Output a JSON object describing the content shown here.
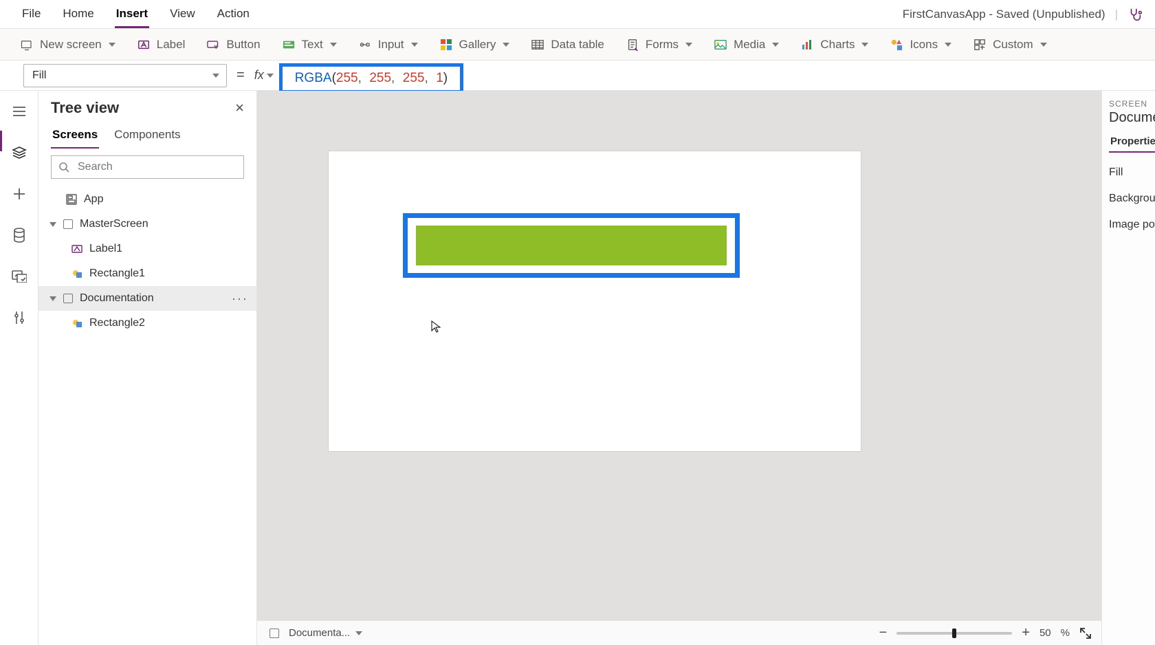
{
  "appTitle": "FirstCanvasApp - Saved (Unpublished)",
  "menu": {
    "items": [
      "File",
      "Home",
      "Insert",
      "View",
      "Action"
    ],
    "activeIndex": 2
  },
  "ribbon": {
    "newScreen": "New screen",
    "label": "Label",
    "button": "Button",
    "text": "Text",
    "input": "Input",
    "gallery": "Gallery",
    "dataTable": "Data table",
    "forms": "Forms",
    "media": "Media",
    "charts": "Charts",
    "icons": "Icons",
    "custom": "Custom"
  },
  "formula": {
    "property": "Fill",
    "fxLabel": "fx",
    "tokens": {
      "func": "RGBA",
      "open": "(",
      "n1": "255",
      "c": ",",
      "n2": "255",
      "n3": "255",
      "n4": "1",
      "close": ")"
    }
  },
  "treePanel": {
    "title": "Tree view",
    "tabs": {
      "screens": "Screens",
      "components": "Components",
      "activeIndex": 0
    },
    "searchPlaceholder": "Search",
    "appNode": "App",
    "items": [
      {
        "kind": "screen",
        "name": "MasterScreen",
        "expanded": true,
        "selected": false
      },
      {
        "kind": "label",
        "name": "Label1",
        "selected": false
      },
      {
        "kind": "shape",
        "name": "Rectangle1",
        "selected": false
      },
      {
        "kind": "screen",
        "name": "Documentation",
        "expanded": true,
        "selected": true
      },
      {
        "kind": "shape",
        "name": "Rectangle2",
        "selected": false
      }
    ]
  },
  "propsPanel": {
    "screenLabel": "SCREEN",
    "screenName": "Document",
    "tab": "Properties",
    "rows": [
      "Fill",
      "Background",
      "Image posi"
    ]
  },
  "statusbar": {
    "screenLabel": "Documenta...",
    "zoomPercent": "50",
    "percentSign": "%"
  },
  "colors": {
    "highlightBlue": "#1b75e3",
    "green": "#8fbd27"
  }
}
